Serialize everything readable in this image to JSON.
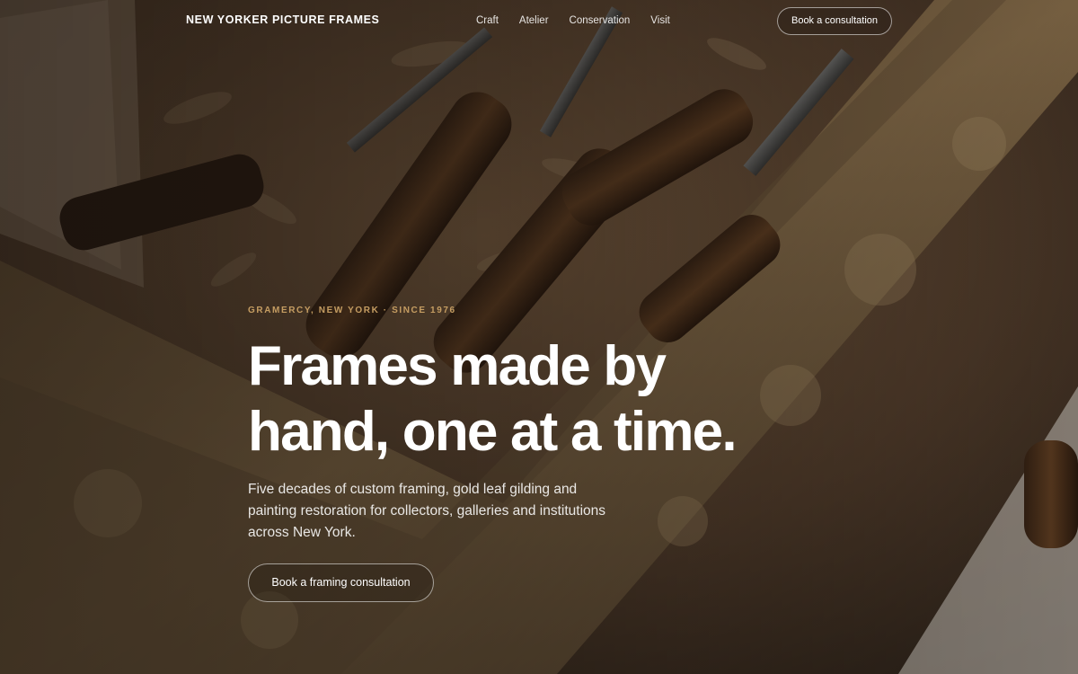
{
  "brand": {
    "name": "NEW YORKER PICTURE FRAMES"
  },
  "nav": {
    "links": [
      "Craft",
      "Atelier",
      "Conservation",
      "Visit"
    ],
    "cta_label": "Book a consultation"
  },
  "hero": {
    "background": "photo-carving-chisels-on-gilded-frame",
    "eyebrow": "GRAMERCY, NEW YORK · SINCE 1976",
    "headline_lines": [
      "Frames made by",
      "hand, one at a time."
    ],
    "lead_lines": [
      "Five decades of custom framing, gold leaf gilding and",
      "painting restoration for collectors, galleries and institutions",
      "across New York."
    ],
    "cta_label": "Book a framing consultation"
  },
  "colors": {
    "accent": "#c59d62",
    "text": "#ffffff",
    "overlay": "#14100b"
  }
}
